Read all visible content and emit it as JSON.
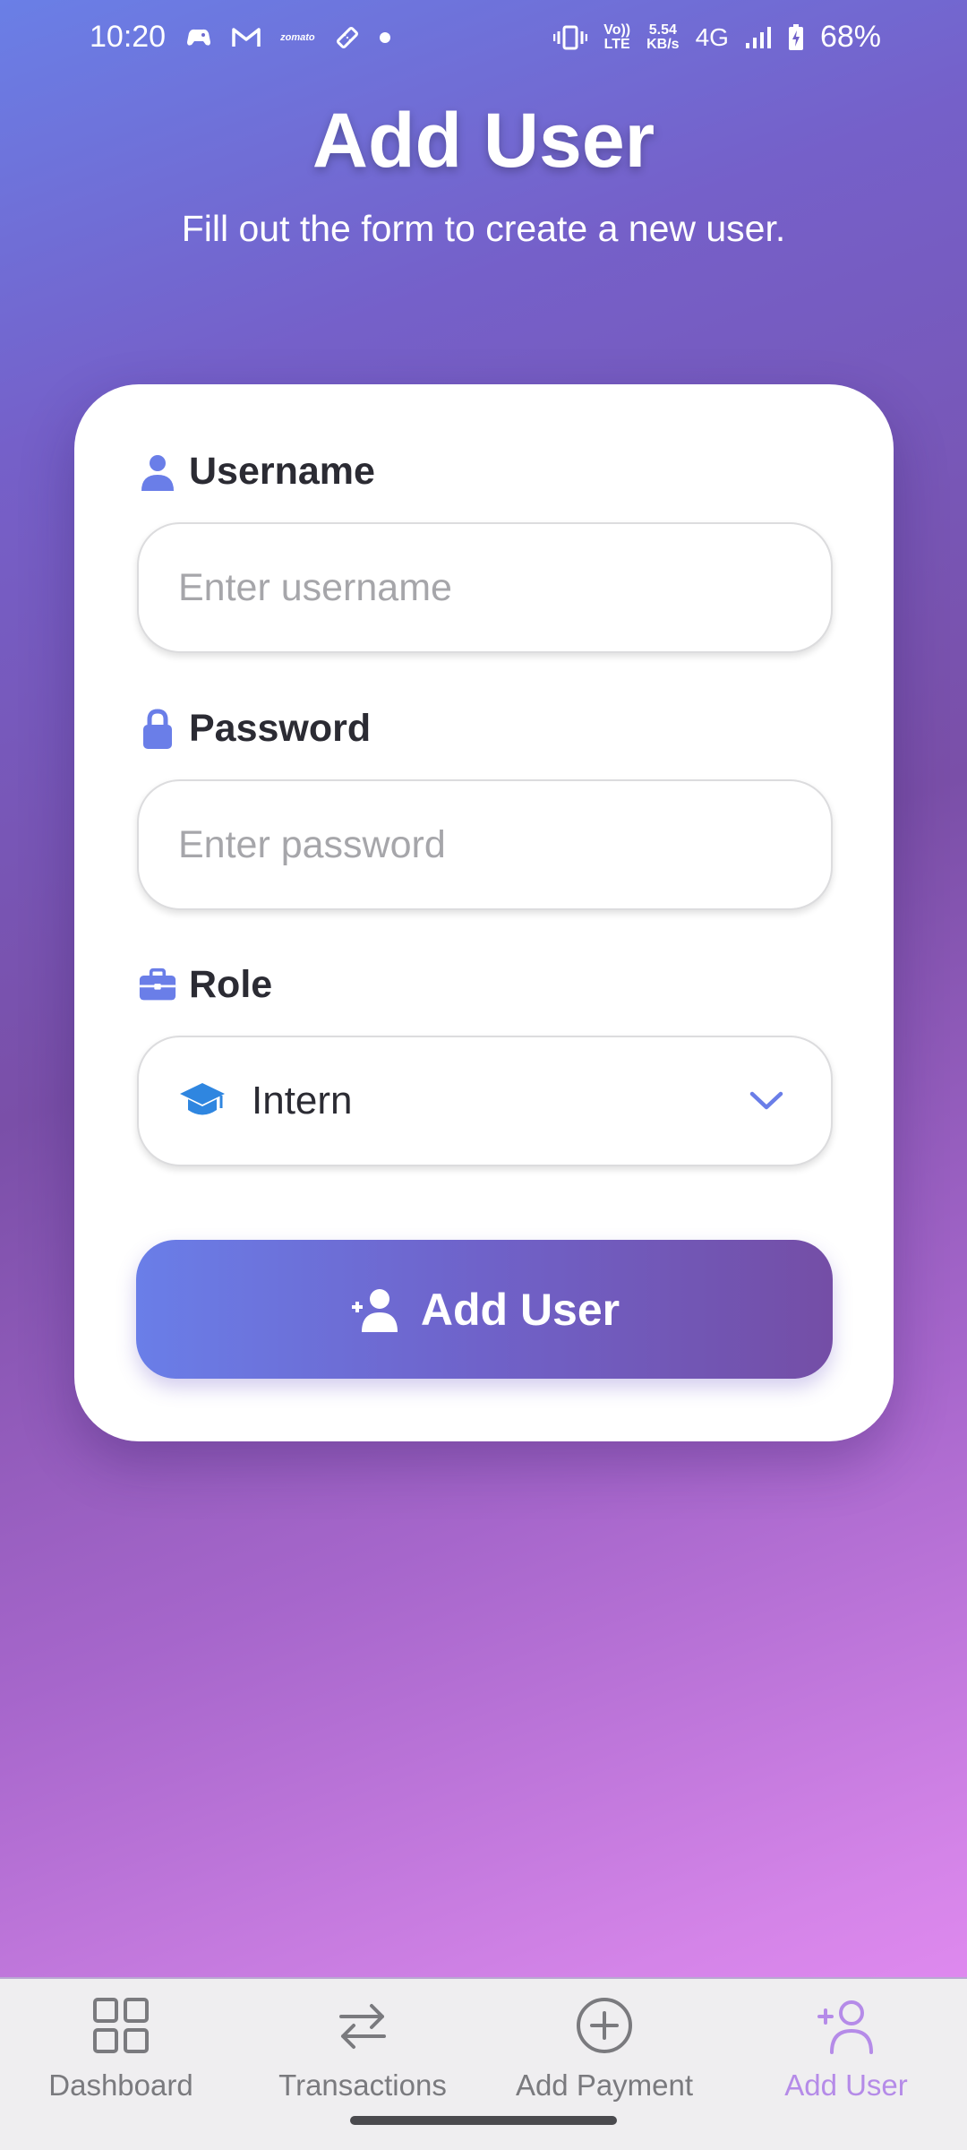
{
  "status_bar": {
    "time": "10:20",
    "network_speed_top": "5.54",
    "network_speed_bottom": "KB/s",
    "volte_top": "Vo))",
    "volte_bottom": "LTE",
    "network_type": "4G",
    "battery": "68%",
    "left_icons": [
      "game-controller-icon",
      "gmail-icon",
      "zomato-icon",
      "ticket-icon",
      "notification-dot-icon"
    ],
    "right_icons": [
      "vibrate-icon",
      "signal-icon",
      "battery-charging-icon"
    ]
  },
  "header": {
    "title": "Add User",
    "subtitle": "Fill out the form to create a new user."
  },
  "form": {
    "username": {
      "label": "Username",
      "icon": "user-icon",
      "placeholder": "Enter username",
      "value": ""
    },
    "password": {
      "label": "Password",
      "icon": "lock-icon",
      "placeholder": "Enter password",
      "value": ""
    },
    "role": {
      "label": "Role",
      "icon": "briefcase-icon",
      "selected": "Intern",
      "selected_icon": "graduation-cap-icon"
    },
    "submit_label": "Add User"
  },
  "bottom_nav": {
    "items": [
      {
        "label": "Dashboard",
        "icon": "grid-icon",
        "active": false
      },
      {
        "label": "Transactions",
        "icon": "arrows-swap-icon",
        "active": false
      },
      {
        "label": "Add Payment",
        "icon": "plus-circle-icon",
        "active": false
      },
      {
        "label": "Add User",
        "icon": "add-user-icon",
        "active": true
      }
    ]
  },
  "colors": {
    "accent": "#6a7ee8",
    "accent_dark": "#744ea6",
    "nav_active": "#b58be8",
    "role_icon": "#2f86e0"
  }
}
